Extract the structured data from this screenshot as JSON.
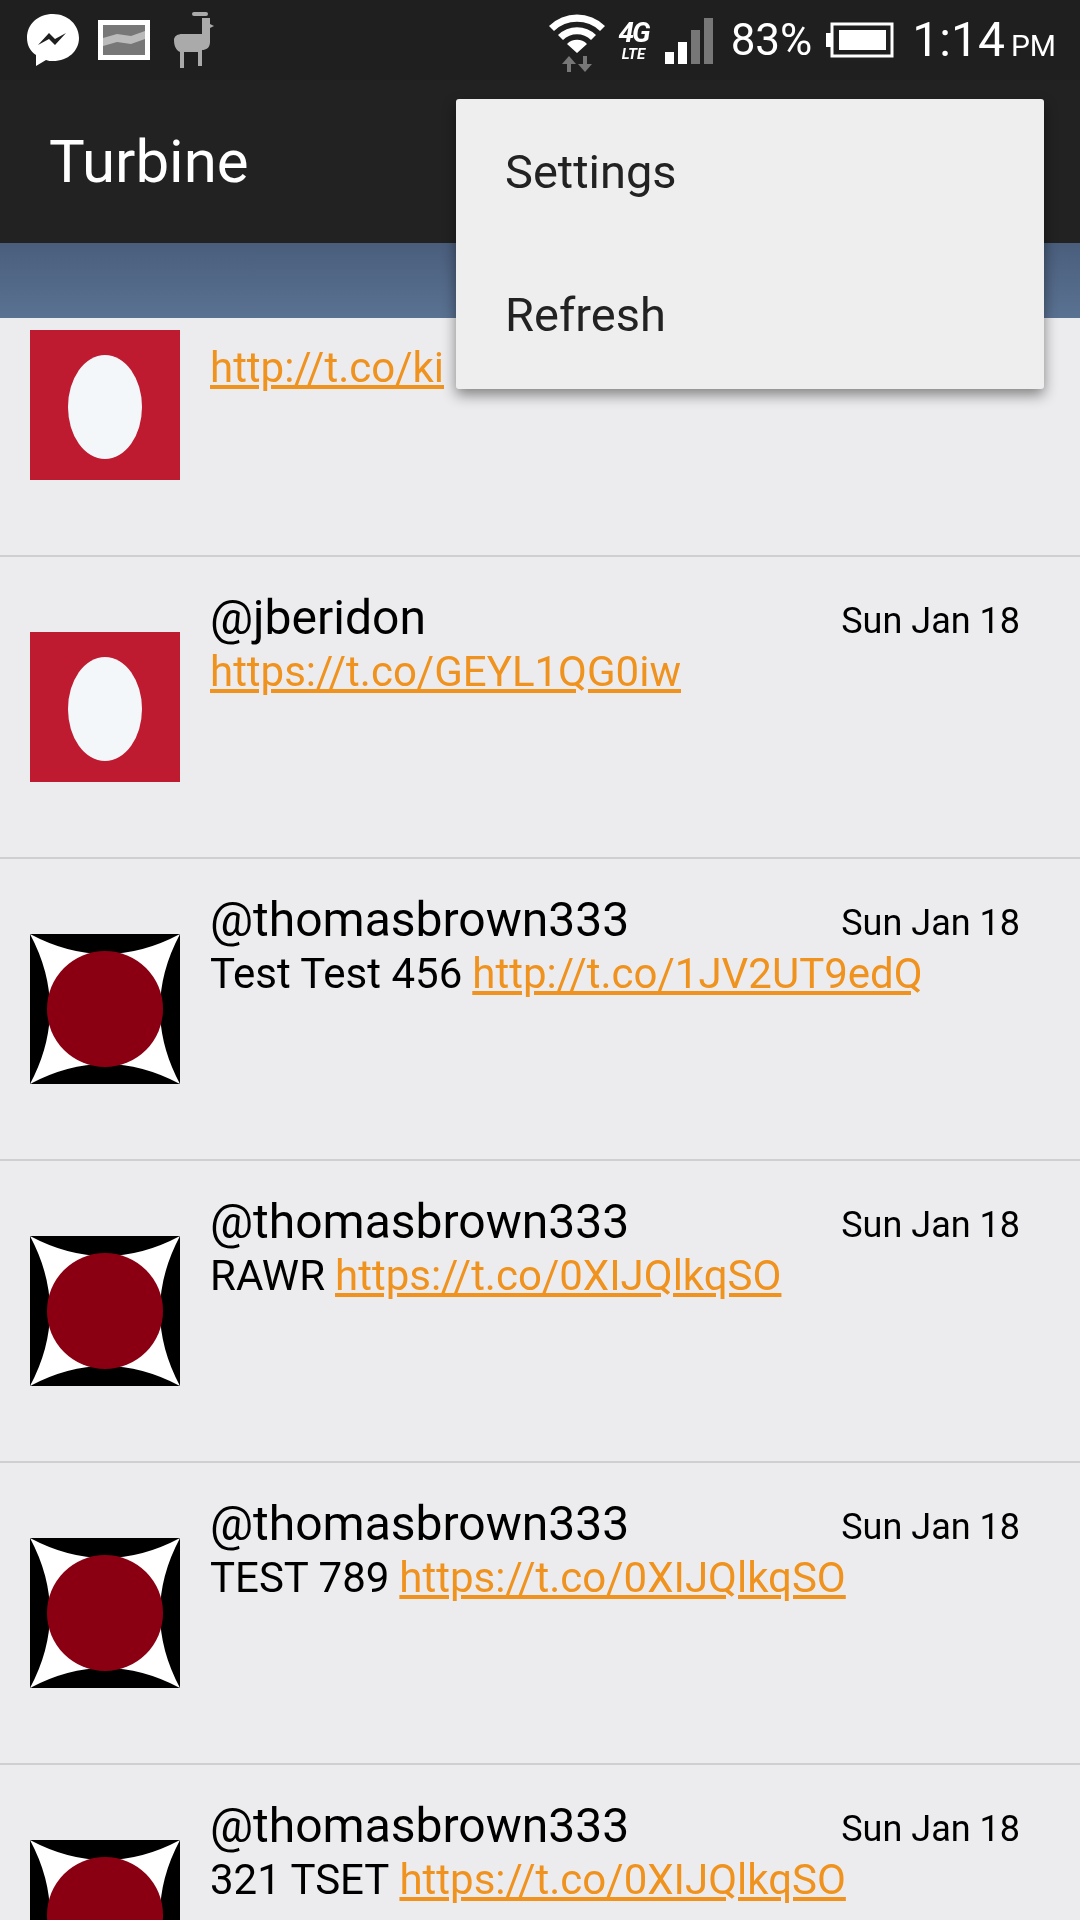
{
  "status_bar": {
    "network_type": "4G",
    "network_sub": "LTE",
    "battery": "83%",
    "time": "1:14",
    "ampm": "PM"
  },
  "app_bar": {
    "title": "Turbine"
  },
  "menu": {
    "items": [
      "Settings",
      "Refresh"
    ]
  },
  "tweets": [
    {
      "link": "http://t.co/ki",
      "kind": "egg"
    },
    {
      "handle": "@jberidon",
      "date": "Sun Jan 18",
      "link": "https://t.co/GEYL1QG0iw",
      "kind": "egg"
    },
    {
      "handle": "@thomasbrown333",
      "date": "Sun Jan 18",
      "text": "Test Test 456",
      "link": "http://t.co/1JV2UT9edQ",
      "kind": "circle"
    },
    {
      "handle": "@thomasbrown333",
      "date": "Sun Jan 18",
      "text": "RAWR",
      "link": "https://t.co/0XIJQlkqSO",
      "kind": "circle"
    },
    {
      "handle": "@thomasbrown333",
      "date": "Sun Jan 18",
      "text": "TEST 789",
      "link": "https://t.co/0XIJQlkqSO",
      "kind": "circle"
    },
    {
      "handle": "@thomasbrown333",
      "date": "Sun Jan 18",
      "text": "321 TSET",
      "link": "https://t.co/0XIJQlkqSO",
      "kind": "circle"
    }
  ]
}
